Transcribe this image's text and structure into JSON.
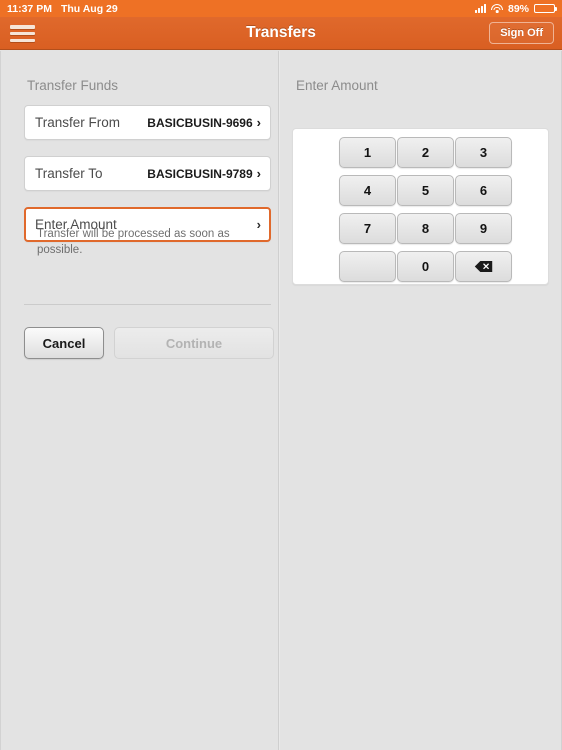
{
  "status_bar": {
    "time": "11:37 PM",
    "date": "Thu Aug 29",
    "battery_percent": "89%",
    "signal_icon": "cellular-signal-icon",
    "wifi_icon": "wifi-icon",
    "battery_icon": "battery-icon"
  },
  "nav": {
    "menu_icon": "hamburger-menu-icon",
    "title": "Transfers",
    "sign_off_label": "Sign Off"
  },
  "theme": {
    "accent": "#e0692c",
    "status_bar_orange": "#ee7125",
    "page_background": "#e3e3e3",
    "focus_border": "#e0692c"
  },
  "left_pane": {
    "section_label": "Transfer Funds",
    "fields": [
      {
        "label": "Transfer From",
        "value": "BASICBUSIN-9696",
        "chevron": "›",
        "focused": false
      },
      {
        "label": "Transfer To",
        "value": "BASICBUSIN-9789",
        "chevron": "›",
        "focused": false
      },
      {
        "label": "Enter Amount",
        "value": "",
        "chevron": "›",
        "focused": true
      }
    ],
    "hint_text": "Transfer will be processed as soon as possible.",
    "buttons": {
      "cancel_label": "Cancel",
      "continue_label": "Continue",
      "continue_disabled": true
    }
  },
  "right_pane": {
    "keypad_label": "Enter Amount",
    "keys": [
      {
        "label": "1",
        "name": "key-1",
        "type": "digit"
      },
      {
        "label": "2",
        "name": "key-2",
        "type": "digit"
      },
      {
        "label": "3",
        "name": "key-3",
        "type": "digit"
      },
      {
        "label": "4",
        "name": "key-4",
        "type": "digit"
      },
      {
        "label": "5",
        "name": "key-5",
        "type": "digit"
      },
      {
        "label": "6",
        "name": "key-6",
        "type": "digit"
      },
      {
        "label": "7",
        "name": "key-7",
        "type": "digit"
      },
      {
        "label": "8",
        "name": "key-8",
        "type": "digit"
      },
      {
        "label": "9",
        "name": "key-9",
        "type": "digit"
      },
      {
        "label": "",
        "name": "key-blank",
        "type": "blank"
      },
      {
        "label": "0",
        "name": "key-0",
        "type": "digit"
      },
      {
        "label": "",
        "name": "key-backspace",
        "type": "backspace"
      }
    ]
  }
}
